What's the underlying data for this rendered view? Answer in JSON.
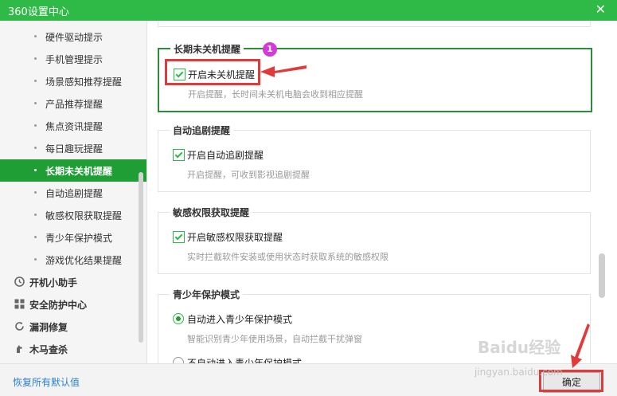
{
  "window": {
    "title": "360设置中心",
    "close": "✕"
  },
  "sidebar": {
    "sub_items": [
      {
        "label": "硬件驱动提示"
      },
      {
        "label": "手机管理提示"
      },
      {
        "label": "场景感知推荐提醒"
      },
      {
        "label": "产品推荐提醒"
      },
      {
        "label": "焦点资讯提醒"
      },
      {
        "label": "每日趣玩提醒"
      },
      {
        "label": "长期未关机提醒"
      },
      {
        "label": "自动追剧提醒"
      },
      {
        "label": "敏感权限获取提醒"
      },
      {
        "label": "青少年保护模式"
      },
      {
        "label": "游戏优化结果提醒"
      }
    ],
    "main_items": [
      {
        "label": "开机小助手",
        "icon": "clock-icon"
      },
      {
        "label": "安全防护中心",
        "icon": "grid-icon"
      },
      {
        "label": "漏洞修复",
        "icon": "refresh-icon"
      },
      {
        "label": "木马查杀",
        "icon": "horse-icon"
      }
    ],
    "active_label": "长期未关机提醒"
  },
  "sections": {
    "long_running": {
      "title": "长期未关机提醒",
      "option": "开启未关机提醒",
      "desc": "开启提醒，长时间未关机电脑会收到相应提醒"
    },
    "auto_drama": {
      "title": "自动追剧提醒",
      "option": "开启自动追剧提醒",
      "desc": "开启提醒，可收到影视追剧提醒"
    },
    "sensitive": {
      "title": "敏感权限获取提醒",
      "option": "开启敏感权限获取提醒",
      "desc": "实时拦截软件安装或使用状态时获取系统的敏感权限"
    },
    "youth": {
      "title": "青少年保护模式",
      "option_on": "自动进入青少年保护模式",
      "desc": "智能识别青少年使用场景，自动拦截干扰弹窗",
      "option_off": "不自动进入青少年保护模式"
    }
  },
  "footer": {
    "reset": "恢复所有默认值",
    "ok": "确定"
  },
  "annotation": {
    "step": "1"
  },
  "watermark": {
    "brand": "Baidu经验",
    "url": "jingyan.baidu.com"
  },
  "colors": {
    "brand_green": "#2fb946",
    "active_green": "#1e9e35",
    "annotation_red": "#e23a3a",
    "link_blue": "#2b7fd0"
  }
}
